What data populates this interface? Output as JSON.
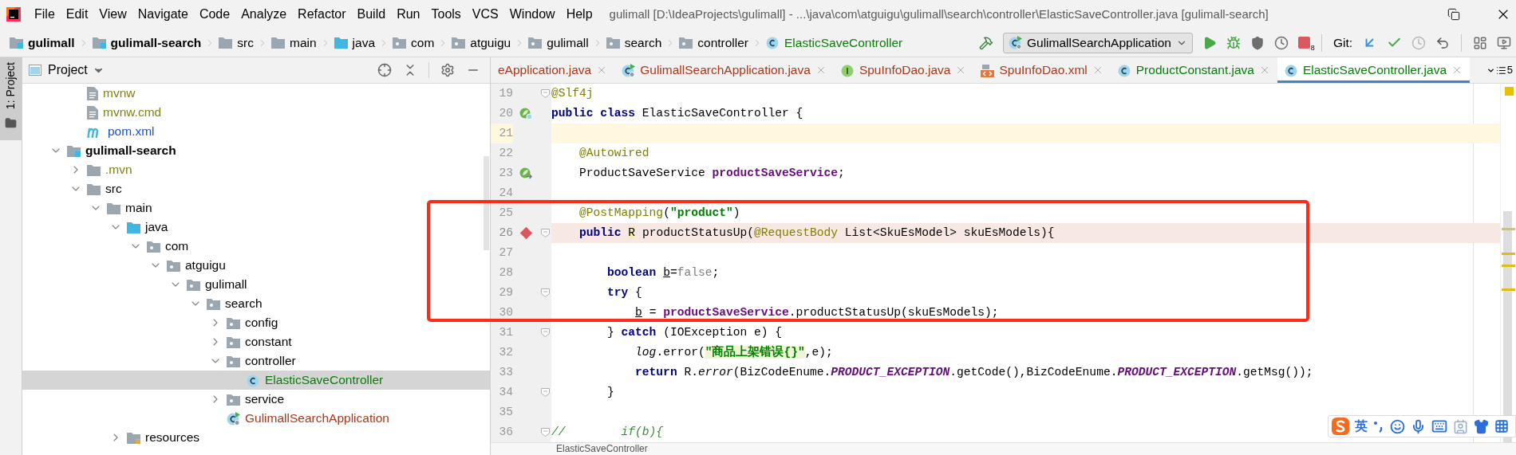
{
  "window": {
    "title": "gulimall [D:\\IdeaProjects\\gulimall] - ...\\java\\com\\atguigu\\gulimall\\search\\controller\\ElasticSaveController.java [gulimall-search]"
  },
  "menu": [
    "File",
    "Edit",
    "View",
    "Navigate",
    "Code",
    "Analyze",
    "Refactor",
    "Build",
    "Run",
    "Tools",
    "VCS",
    "Window",
    "Help"
  ],
  "breadcrumbs": [
    {
      "label": "gulimall",
      "kind": "module"
    },
    {
      "label": "gulimall-search",
      "kind": "module"
    },
    {
      "label": "src",
      "kind": "folder"
    },
    {
      "label": "main",
      "kind": "folder"
    },
    {
      "label": "java",
      "kind": "source-root"
    },
    {
      "label": "com",
      "kind": "package"
    },
    {
      "label": "atguigu",
      "kind": "package"
    },
    {
      "label": "gulimall",
      "kind": "package"
    },
    {
      "label": "search",
      "kind": "package"
    },
    {
      "label": "controller",
      "kind": "package"
    },
    {
      "label": "ElasticSaveController",
      "kind": "class",
      "color": "#0b7d0b"
    }
  ],
  "toolbar": {
    "run_config": "GulimallSearchApplication",
    "stop_badge": "8",
    "git_label": "Git:"
  },
  "tool_stripe": {
    "label": "1: Project",
    "selected": true
  },
  "project": {
    "title": "Project",
    "tree": [
      {
        "name": "mvnw",
        "kind": "script",
        "color": "#7f7f16",
        "selected": false
      },
      {
        "name": "mvnw.cmd",
        "kind": "text",
        "color": "#7f7f16",
        "selected": false
      },
      {
        "name": "pom.xml",
        "kind": "maven",
        "color": "#1d4fcf",
        "selected": false
      },
      {
        "name": "gulimall-search",
        "kind": "module",
        "expanded": true,
        "selected": false,
        "children": [
          {
            "name": ".mvn",
            "kind": "folder",
            "color": "#7f7f16",
            "expanded": false,
            "selected": false
          },
          {
            "name": "src",
            "kind": "folder",
            "expanded": true,
            "selected": false,
            "children": [
              {
                "name": "main",
                "kind": "folder",
                "expanded": true,
                "selected": false,
                "children": [
                  {
                    "name": "java",
                    "kind": "source-root",
                    "expanded": true,
                    "selected": false,
                    "children": [
                      {
                        "name": "com",
                        "kind": "package",
                        "expanded": true,
                        "selected": false,
                        "children": [
                          {
                            "name": "atguigu",
                            "kind": "package",
                            "expanded": true,
                            "selected": false,
                            "children": [
                              {
                                "name": "gulimall",
                                "kind": "package",
                                "expanded": true,
                                "selected": false,
                                "children": [
                                  {
                                    "name": "search",
                                    "kind": "package",
                                    "expanded": true,
                                    "selected": false,
                                    "children": [
                                      {
                                        "name": "config",
                                        "kind": "package",
                                        "expanded": false,
                                        "selected": false
                                      },
                                      {
                                        "name": "constant",
                                        "kind": "package",
                                        "expanded": false,
                                        "selected": false
                                      },
                                      {
                                        "name": "controller",
                                        "kind": "package",
                                        "expanded": true,
                                        "selected": false,
                                        "children": [
                                          {
                                            "name": "ElasticSaveController",
                                            "kind": "class",
                                            "color": "#0b7d0b",
                                            "selected": true
                                          }
                                        ]
                                      },
                                      {
                                        "name": "service",
                                        "kind": "package",
                                        "expanded": false,
                                        "selected": false
                                      },
                                      {
                                        "name": "GulimallSearchApplication",
                                        "kind": "app-class",
                                        "color": "#a8391a",
                                        "selected": false
                                      }
                                    ]
                                  }
                                ]
                              }
                            ]
                          }
                        ]
                      }
                    ]
                  },
                  {
                    "name": "resources",
                    "kind": "resources",
                    "expanded": false,
                    "selected": false
                  }
                ]
              }
            ]
          }
        ]
      }
    ]
  },
  "tabs": [
    {
      "label": "eApplication.java",
      "color": "#a8391a",
      "selected": false
    },
    {
      "label": "GulimallSearchApplication.java",
      "kind": "app-class",
      "color": "#a8391a",
      "selected": false
    },
    {
      "label": "SpuInfoDao.java",
      "kind": "interface",
      "color": "#a8391a",
      "selected": false
    },
    {
      "label": "SpuInfoDao.xml",
      "kind": "xml",
      "color": "#a8391a",
      "selected": false
    },
    {
      "label": "ProductConstant.java",
      "kind": "class",
      "color": "#0b7d0b",
      "selected": false
    },
    {
      "label": "ElasticSaveController.java",
      "kind": "class",
      "color": "#0b7d0b",
      "selected": true
    }
  ],
  "tab_overflow": "5",
  "code": {
    "lines": [
      {
        "number": "19",
        "caret_line": false,
        "breakpoint": false,
        "fold": true,
        "segments": [
          {
            "kind": "annotation",
            "text": "@Slf4j"
          }
        ]
      },
      {
        "number": "20",
        "caret_line": false,
        "breakpoint": false,
        "fold": false,
        "kind": "bean",
        "segments": [
          {
            "kind": "keyword",
            "text": "public class"
          },
          {
            "kind": "plain",
            "text": " ElasticSaveController {"
          }
        ]
      },
      {
        "number": "21",
        "caret_line": true,
        "breakpoint": false,
        "fold": false
      },
      {
        "number": "22",
        "caret_line": false,
        "breakpoint": false,
        "fold": false,
        "segments": [
          {
            "kind": "annotation",
            "text": "    @Autowired"
          }
        ]
      },
      {
        "number": "23",
        "caret_line": false,
        "breakpoint": false,
        "fold": false,
        "kind": "bean-inject",
        "segments": [
          {
            "kind": "plain",
            "text": "    ProductSaveService "
          },
          {
            "kind": "field",
            "text": "productSaveService"
          },
          {
            "kind": "plain",
            "text": ";"
          }
        ]
      },
      {
        "number": "24",
        "caret_line": false,
        "breakpoint": false,
        "fold": false
      },
      {
        "number": "25",
        "caret_line": false,
        "breakpoint": false,
        "fold": false,
        "segments": [
          {
            "kind": "annotation",
            "text": "    @PostMapping"
          },
          {
            "kind": "plain",
            "text": "("
          },
          {
            "kind": "string",
            "text": "\"product\""
          },
          {
            "kind": "plain",
            "text": ")"
          }
        ]
      },
      {
        "number": "26",
        "caret_line": false,
        "breakpoint": true,
        "fold": true,
        "segments": [
          {
            "kind": "keyword",
            "text": "    public "
          },
          {
            "kind": "usage",
            "text": "R"
          },
          {
            "kind": "plain",
            "text": " productStatusUp("
          },
          {
            "kind": "annotation",
            "text": "@RequestBody"
          },
          {
            "kind": "plain",
            "text": " List<SkuEsModel> skuEsModels){"
          }
        ]
      },
      {
        "number": "27",
        "caret_line": false,
        "breakpoint": false,
        "fold": false
      },
      {
        "number": "28",
        "caret_line": false,
        "breakpoint": false,
        "fold": false,
        "segments": [
          {
            "kind": "keyword",
            "text": "        boolean "
          },
          {
            "kind": "reassigned",
            "text": "b"
          },
          {
            "kind": "plain",
            "text": "="
          },
          {
            "kind": "unused",
            "text": "false"
          },
          {
            "kind": "plain",
            "text": ";"
          }
        ]
      },
      {
        "number": "29",
        "caret_line": false,
        "breakpoint": false,
        "fold": true,
        "segments": [
          {
            "kind": "keyword",
            "text": "        try"
          },
          {
            "kind": "plain",
            "text": " {"
          }
        ]
      },
      {
        "number": "30",
        "caret_line": false,
        "breakpoint": false,
        "fold": false,
        "segments": [
          {
            "kind": "reassigned",
            "text": "            b"
          },
          {
            "kind": "plain",
            "text": " = "
          },
          {
            "kind": "field",
            "text": "productSaveService"
          },
          {
            "kind": "plain",
            "text": ".productStatusUp(skuEsModels);"
          }
        ]
      },
      {
        "number": "31",
        "caret_line": false,
        "breakpoint": false,
        "fold": true,
        "segments": [
          {
            "kind": "plain",
            "text": "        } "
          },
          {
            "kind": "keyword",
            "text": "catch"
          },
          {
            "kind": "plain",
            "text": " (IOException e) {"
          }
        ]
      },
      {
        "number": "32",
        "caret_line": false,
        "breakpoint": false,
        "fold": false,
        "segments": [
          {
            "kind": "static",
            "text": "            log"
          },
          {
            "kind": "plain",
            "text": ".error("
          },
          {
            "kind": "string-marked",
            "text": "\"商品上架错误{}\""
          },
          {
            "kind": "plain",
            "text": ",e);"
          }
        ]
      },
      {
        "number": "33",
        "caret_line": false,
        "breakpoint": false,
        "fold": false,
        "segments": [
          {
            "kind": "keyword",
            "text": "            return"
          },
          {
            "kind": "plain",
            "text": " R."
          },
          {
            "kind": "static",
            "text": "error"
          },
          {
            "kind": "plain",
            "text": "(BizCodeEnume."
          },
          {
            "kind": "constant",
            "text": "PRODUCT_EXCEPTION"
          },
          {
            "kind": "plain",
            "text": ".getCode(),BizCodeEnume."
          },
          {
            "kind": "constant",
            "text": "PRODUCT_EXCEPTION"
          },
          {
            "kind": "plain",
            "text": ".getMsg());"
          }
        ]
      },
      {
        "number": "34",
        "caret_line": false,
        "breakpoint": false,
        "fold": true,
        "segments": [
          {
            "kind": "plain",
            "text": "        }"
          }
        ]
      },
      {
        "number": "35",
        "caret_line": false,
        "breakpoint": false,
        "fold": false
      },
      {
        "number": "36",
        "caret_line": false,
        "breakpoint": false,
        "fold": true,
        "segments": [
          {
            "kind": "comment",
            "text": "//        if(b){"
          }
        ]
      }
    ]
  },
  "editor_breadcrumb": "ElasticSaveController",
  "ime": {
    "mode": "英"
  }
}
